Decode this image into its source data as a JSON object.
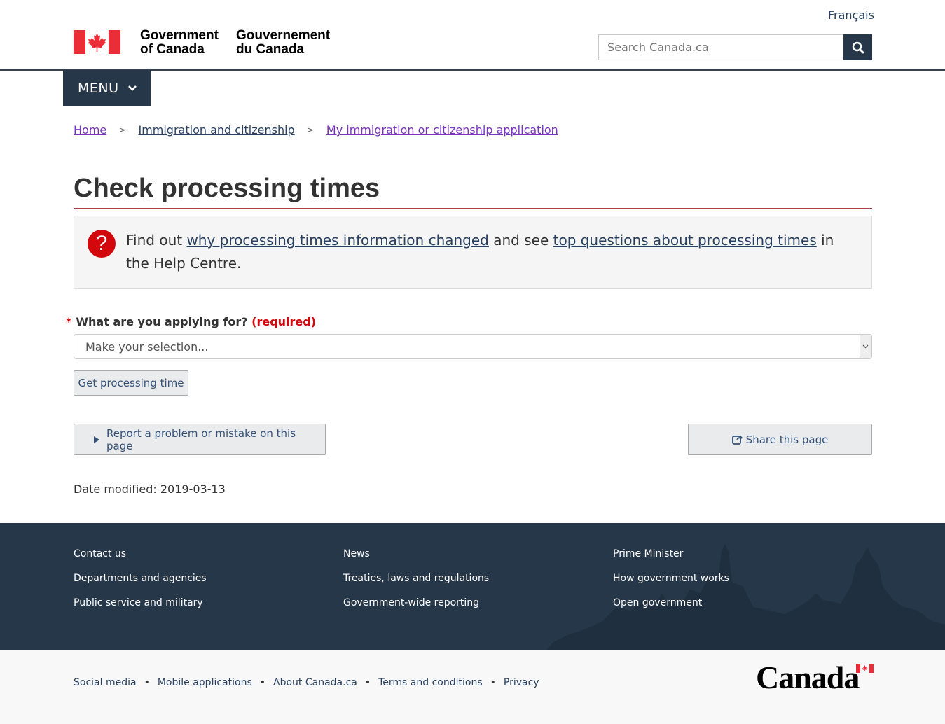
{
  "header": {
    "lang_toggle": "Français",
    "signature_en_line1": "Government",
    "signature_en_line2": "of Canada",
    "signature_fr_line1": "Gouvernement",
    "signature_fr_line2": "du Canada",
    "search_placeholder": "Search Canada.ca",
    "menu_label": "MENU"
  },
  "breadcrumb": [
    {
      "label": "Home"
    },
    {
      "label": "Immigration and citizenship"
    },
    {
      "label": "My immigration or citizenship application"
    }
  ],
  "page": {
    "title": "Check processing times",
    "info": {
      "prefix": "Find out ",
      "link1": "why processing times information changed",
      "middle": " and see ",
      "link2": "top questions about processing times",
      "suffix": " in the Help Centre."
    },
    "form": {
      "label": "What are you applying for?",
      "required_text": "(required)",
      "required_marker": "*",
      "select_value": "Make your selection...",
      "submit_label": "Get processing time"
    },
    "report_label": "Report a problem or mistake on this page",
    "share_label": "Share this page",
    "date_modified": "Date modified: 2019-03-13"
  },
  "footer": {
    "col1": [
      "Contact us",
      "Departments and agencies",
      "Public service and military"
    ],
    "col2": [
      "News",
      "Treaties, laws and regulations",
      "Government-wide reporting"
    ],
    "col3": [
      "Prime Minister",
      "How government works",
      "Open government"
    ],
    "sub_links": [
      "Social media",
      "Mobile applications",
      "About Canada.ca",
      "Terms and conditions",
      "Privacy"
    ],
    "wordmark": "Canada"
  },
  "colors": {
    "brand_dark": "#26374a",
    "link": "#284162",
    "visited": "#7834bc",
    "accent_red": "#d3080c",
    "title_rule": "#af3c43"
  },
  "icons": [
    "canada-flag-icon",
    "search-icon",
    "chevron-down-icon",
    "question-icon",
    "caret-right-icon",
    "share-icon"
  ]
}
